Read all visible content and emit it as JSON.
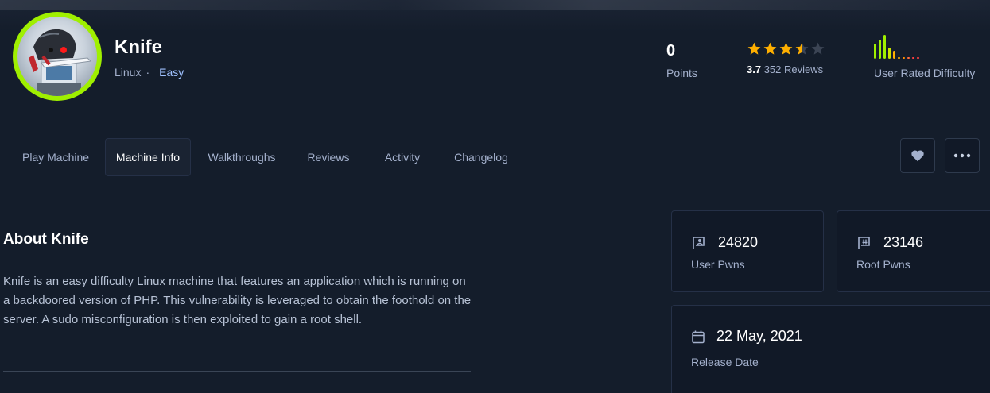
{
  "machine": {
    "name": "Knife",
    "os": "Linux",
    "separator": "·",
    "difficulty": "Easy"
  },
  "stats": {
    "points_value": "0",
    "points_label": "Points",
    "rating_value": "3.7",
    "rating_stars": 3.5,
    "reviews_text": "352 Reviews",
    "difficulty_label": "User Rated Difficulty",
    "difficulty_distribution": [
      {
        "level": 1,
        "fraction": 0.6,
        "color": "#9fef00"
      },
      {
        "level": 2,
        "fraction": 0.75,
        "color": "#9fef00"
      },
      {
        "level": 3,
        "fraction": 0.95,
        "color": "#9fef00"
      },
      {
        "level": 4,
        "fraction": 0.45,
        "color": "#c9e400"
      },
      {
        "level": 5,
        "fraction": 0.3,
        "color": "#ffaf00"
      },
      {
        "level": 6,
        "fraction": 0.06,
        "color": "#ffaf00"
      },
      {
        "level": 7,
        "fraction": 0.05,
        "color": "#ff8c00"
      },
      {
        "level": 8,
        "fraction": 0.05,
        "color": "#ff6c3e"
      },
      {
        "level": 9,
        "fraction": 0.05,
        "color": "#ff3e3e"
      },
      {
        "level": 10,
        "fraction": 0.05,
        "color": "#ff3e3e"
      }
    ]
  },
  "tabs": [
    {
      "label": "Play Machine",
      "active": false
    },
    {
      "label": "Machine Info",
      "active": true
    },
    {
      "label": "Walkthroughs",
      "active": false
    },
    {
      "label": "Reviews",
      "active": false
    },
    {
      "label": "Activity",
      "active": false
    },
    {
      "label": "Changelog",
      "active": false
    }
  ],
  "actions": {
    "favorite_icon": "heart-icon",
    "more_icon": "more-horizontal-icon"
  },
  "about": {
    "title": "About Knife",
    "description": "Knife is an easy difficulty Linux machine that features an application which is running on a backdoored version of PHP. This vulnerability is leveraged to obtain the foothold on the server. A sudo misconfiguration is then exploited to gain a root shell."
  },
  "cards": {
    "user_pwns_value": "24820",
    "user_pwns_label": "User Pwns",
    "root_pwns_value": "23146",
    "root_pwns_label": "Root Pwns",
    "release_date_value": "22 May, 2021",
    "release_date_label": "Release Date"
  },
  "colors": {
    "background": "#141d2b",
    "card": "#111927",
    "accent_green": "#9fef00",
    "star": "#ffaf00",
    "link": "#9fc1ff",
    "muted": "#a4b1cd"
  }
}
